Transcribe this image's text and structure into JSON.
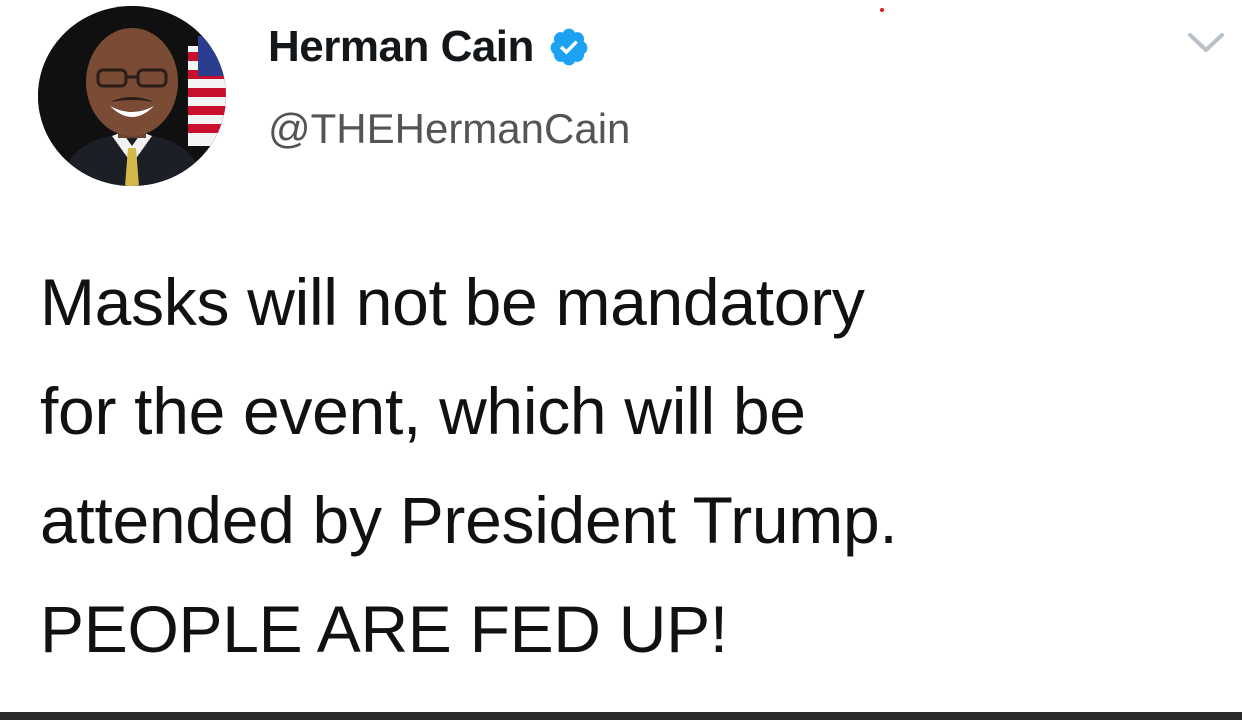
{
  "tweet": {
    "author": {
      "display_name": "Herman Cain",
      "handle": "@THEHermanCain",
      "verified": true
    },
    "body_lines": [
      "Masks will not be mandatory",
      "for the event, which will be",
      "attended by President Trump.",
      "PEOPLE ARE FED UP!"
    ]
  },
  "icons": {
    "verified": "verified-badge-icon",
    "menu": "chevron-down-icon"
  },
  "colors": {
    "verified_blue": "#1da1f2",
    "text_primary": "#14171a",
    "text_secondary": "#545454",
    "chevron": "#b8c0c8"
  }
}
